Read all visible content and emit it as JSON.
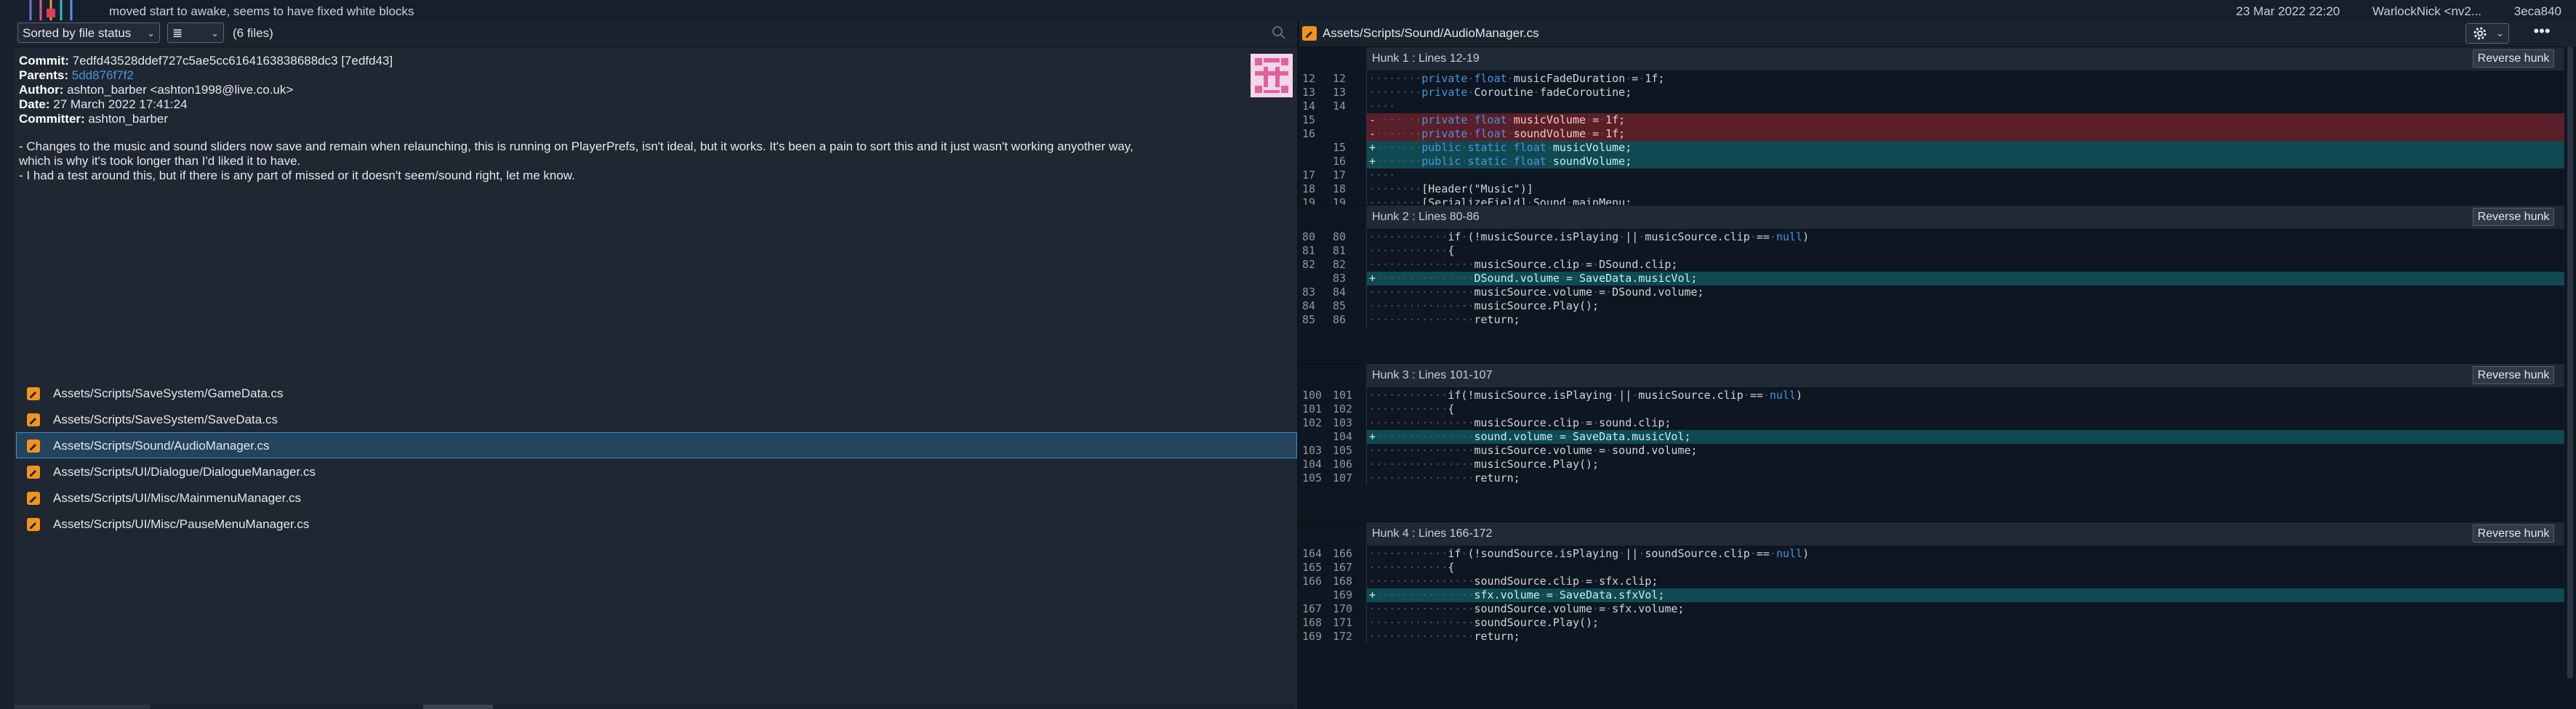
{
  "top_strip": {
    "message": "moved start to awake, seems to have fixed white blocks",
    "date": "23 Mar 2022 22:20",
    "author": "WarlockNick <nv2...",
    "sha": "3eca840"
  },
  "left_toolbar": {
    "sort_label": "Sorted by file status",
    "view_label": "≣",
    "file_count": "(6 files)"
  },
  "commit": {
    "commit_label": "Commit:",
    "commit_value": "7edfd43528ddef727c5ae5cc6164163838688dc3 [7edfd43]",
    "parents_label": "Parents:",
    "parents_value": "5dd876f7f2",
    "author_label": "Author:",
    "author_value": "ashton_barber <ashton1998@live.co.uk>",
    "date_label": "Date:",
    "date_value": "27 March 2022 17:41:24",
    "committer_label": "Committer:",
    "committer_value": "ashton_barber",
    "message_lines": [
      "- Changes to the music and sound sliders now save and remain when relaunching, this is running on PlayerPrefs, isn't ideal, but it works. It's been a pain to sort this and it just wasn't working anyother way,",
      "which is why it's took longer than I'd liked it to have.",
      "- I had a test around this, but if there is any part of missed or it doesn't seem/sound right, let me know."
    ]
  },
  "files": [
    {
      "path": "Assets/Scripts/SaveSystem/GameData.cs",
      "selected": false
    },
    {
      "path": "Assets/Scripts/SaveSystem/SaveData.cs",
      "selected": false
    },
    {
      "path": "Assets/Scripts/Sound/AudioManager.cs",
      "selected": true
    },
    {
      "path": "Assets/Scripts/UI/Dialogue/DialogueManager.cs",
      "selected": false
    },
    {
      "path": "Assets/Scripts/UI/Misc/MainmenuManager.cs",
      "selected": false
    },
    {
      "path": "Assets/Scripts/UI/Misc/PauseMenuManager.cs",
      "selected": false
    }
  ],
  "diff": {
    "path": "Assets/Scripts/Sound/AudioManager.cs",
    "reverse_label": "Reverse hunk",
    "hunks": [
      {
        "title": "Hunk 1 : Lines 12-19",
        "lines": [
          {
            "o": "12",
            "n": "12",
            "t": "ctx",
            "code": "········private·float·musicFadeDuration·=·1f;"
          },
          {
            "o": "13",
            "n": "13",
            "t": "ctx",
            "code": "········private·Coroutine·fadeCoroutine;"
          },
          {
            "o": "14",
            "n": "14",
            "t": "ctx",
            "code": "····"
          },
          {
            "o": "15",
            "n": "",
            "t": "del",
            "code": "-·······private·float·musicVolume·=·1f;"
          },
          {
            "o": "16",
            "n": "",
            "t": "del",
            "code": "-·······private·float·soundVolume·=·1f;"
          },
          {
            "o": "",
            "n": "15",
            "t": "add",
            "code": "+·······public·static·float·musicVolume;"
          },
          {
            "o": "",
            "n": "16",
            "t": "add",
            "code": "+·······public·static·float·soundVolume;"
          },
          {
            "o": "17",
            "n": "17",
            "t": "ctx",
            "code": "····"
          },
          {
            "o": "18",
            "n": "18",
            "t": "ctx",
            "code": "········[Header(\"Music\")]"
          },
          {
            "o": "19",
            "n": "19",
            "t": "ctx",
            "code": "········[SerializeField]·Sound·mainMenu;"
          }
        ]
      },
      {
        "title": "Hunk 2 : Lines 80-86",
        "lines": [
          {
            "o": "80",
            "n": "80",
            "t": "ctx",
            "code": "············if·(!musicSource.isPlaying·||·musicSource.clip·==·null)"
          },
          {
            "o": "81",
            "n": "81",
            "t": "ctx",
            "code": "············{"
          },
          {
            "o": "82",
            "n": "82",
            "t": "ctx",
            "code": "················musicSource.clip·=·DSound.clip;"
          },
          {
            "o": "",
            "n": "83",
            "t": "add",
            "code": "+···············DSound.volume·=·SaveData.musicVol;"
          },
          {
            "o": "83",
            "n": "84",
            "t": "ctx",
            "code": "················musicSource.volume·=·DSound.volume;"
          },
          {
            "o": "84",
            "n": "85",
            "t": "ctx",
            "code": "················musicSource.Play();"
          },
          {
            "o": "85",
            "n": "86",
            "t": "ctx",
            "code": "················return;"
          }
        ]
      },
      {
        "title": "Hunk 3 : Lines 101-107",
        "lines": [
          {
            "o": "100",
            "n": "101",
            "t": "ctx",
            "code": "············if(!musicSource.isPlaying·||·musicSource.clip·==·null)"
          },
          {
            "o": "101",
            "n": "102",
            "t": "ctx",
            "code": "············{"
          },
          {
            "o": "102",
            "n": "103",
            "t": "ctx",
            "code": "················musicSource.clip·=·sound.clip;"
          },
          {
            "o": "",
            "n": "104",
            "t": "add",
            "code": "+···············sound.volume·=·SaveData.musicVol;"
          },
          {
            "o": "103",
            "n": "105",
            "t": "ctx",
            "code": "················musicSource.volume·=·sound.volume;"
          },
          {
            "o": "104",
            "n": "106",
            "t": "ctx",
            "code": "················musicSource.Play();"
          },
          {
            "o": "105",
            "n": "107",
            "t": "ctx",
            "code": "················return;"
          }
        ]
      },
      {
        "title": "Hunk 4 : Lines 166-172",
        "lines": [
          {
            "o": "164",
            "n": "166",
            "t": "ctx",
            "code": "············if·(!soundSource.isPlaying·||·soundSource.clip·==·null)"
          },
          {
            "o": "165",
            "n": "167",
            "t": "ctx",
            "code": "············{"
          },
          {
            "o": "166",
            "n": "168",
            "t": "ctx",
            "code": "················soundSource.clip·=·sfx.clip;"
          },
          {
            "o": "",
            "n": "169",
            "t": "add",
            "code": "+···············sfx.volume·=·SaveData.sfxVol;"
          },
          {
            "o": "167",
            "n": "170",
            "t": "ctx",
            "code": "················soundSource.volume·=·sfx.volume;"
          },
          {
            "o": "168",
            "n": "171",
            "t": "ctx",
            "code": "················soundSource.Play();"
          },
          {
            "o": "169",
            "n": "172",
            "t": "ctx",
            "code": "················return;"
          }
        ]
      }
    ]
  },
  "colors": {
    "accent": "#3a8fd0",
    "deleted_line": "#5a1f28",
    "added_line": "#0f4a52",
    "file_icon": "#f0941e",
    "link": "#4c93d9"
  },
  "icons": [
    "search-icon",
    "file-modified-icon",
    "settings-gear-icon",
    "more-icon",
    "chevron-down-icon",
    "avatar"
  ]
}
